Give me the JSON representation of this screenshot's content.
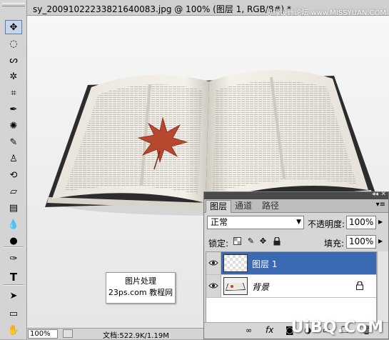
{
  "window": {
    "document_title": "sy_20091022233821640083.jpg @ 100% (图层 1, RGB/8#) *",
    "watermark_top": "思缘设计论坛 www.MISSYUAN.COM"
  },
  "toolbar": {
    "tools": [
      {
        "name": "move-tool-icon",
        "glyph": "✥",
        "active": true
      },
      {
        "name": "marquee-tool-icon",
        "glyph": "◌"
      },
      {
        "name": "lasso-tool-icon",
        "glyph": "ᔕ"
      },
      {
        "name": "magic-wand-tool-icon",
        "glyph": "✲"
      },
      {
        "name": "crop-tool-icon",
        "glyph": "⌗"
      },
      {
        "name": "eyedropper-tool-icon",
        "glyph": "✒"
      },
      {
        "name": "healing-brush-tool-icon",
        "glyph": "✺"
      },
      {
        "name": "brush-tool-icon",
        "glyph": "✎"
      },
      {
        "name": "clone-stamp-tool-icon",
        "glyph": "♙"
      },
      {
        "name": "history-brush-tool-icon",
        "glyph": "⟲"
      },
      {
        "name": "eraser-tool-icon",
        "glyph": "▱"
      },
      {
        "name": "gradient-tool-icon",
        "glyph": "▤"
      },
      {
        "name": "blur-tool-icon",
        "glyph": "💧"
      },
      {
        "name": "dodge-tool-icon",
        "glyph": "●"
      },
      {
        "name": "pen-tool-icon",
        "glyph": "✑"
      },
      {
        "name": "type-tool-icon",
        "glyph": "T"
      },
      {
        "name": "path-selection-tool-icon",
        "glyph": "➤"
      },
      {
        "name": "shape-tool-icon",
        "glyph": "▭"
      },
      {
        "name": "hand-tool-icon",
        "glyph": "✋"
      }
    ]
  },
  "canvas": {
    "stamp_line1": "图片处理",
    "stamp_line2": "23ps.com 教程网"
  },
  "status": {
    "zoom": "100%",
    "doc_size": "文档:522.9K/1.19M"
  },
  "layers_panel": {
    "tabs": [
      "图层",
      "通道",
      "路径"
    ],
    "active_tab": 0,
    "blend_mode": "正常",
    "opacity_label": "不透明度:",
    "opacity_value": "100%",
    "lock_label": "锁定:",
    "fill_label": "填充:",
    "fill_value": "100%",
    "layers": [
      {
        "name": "图层 1",
        "selected": true,
        "visible": true
      },
      {
        "name": "背景",
        "selected": false,
        "visible": true,
        "locked": true
      }
    ]
  },
  "watermark_bottom": "UiBQ.CoM",
  "colors": {
    "selection": "#3a6ab4",
    "panel_bg": "#d6d6d6",
    "leaf": "#b5482e"
  }
}
